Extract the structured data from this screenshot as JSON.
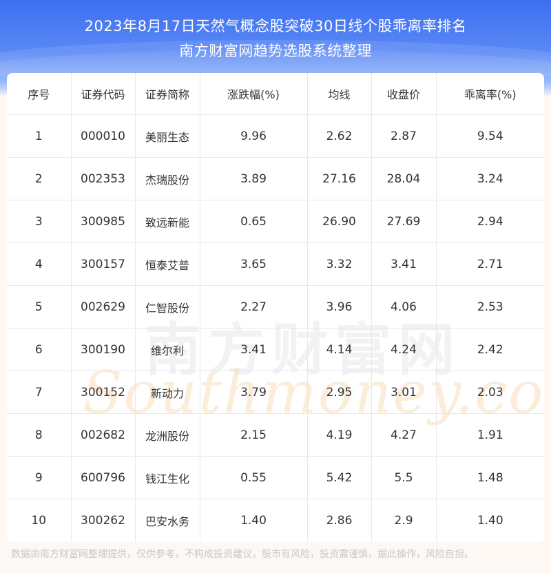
{
  "header": {
    "title_line1": "2023年8月17日天然气概念股突破30日线个股乖离率排名",
    "title_line2": "南方财富网趋势选股系统整理"
  },
  "table": {
    "columns": [
      "序号",
      "证券代码",
      "证券简称",
      "涨跌幅(%)",
      "均线",
      "收盘价",
      "乖离率(%)"
    ],
    "rows": [
      [
        "1",
        "000010",
        "美丽生态",
        "9.96",
        "2.62",
        "2.87",
        "9.54"
      ],
      [
        "2",
        "002353",
        "杰瑞股份",
        "3.89",
        "27.16",
        "28.04",
        "3.24"
      ],
      [
        "3",
        "300985",
        "致远新能",
        "0.65",
        "26.90",
        "27.69",
        "2.94"
      ],
      [
        "4",
        "300157",
        "恒泰艾普",
        "3.65",
        "3.32",
        "3.41",
        "2.71"
      ],
      [
        "5",
        "002629",
        "仁智股份",
        "2.27",
        "3.96",
        "4.06",
        "2.53"
      ],
      [
        "6",
        "300190",
        "维尔利",
        "3.41",
        "4.14",
        "4.24",
        "2.42"
      ],
      [
        "7",
        "300152",
        "新动力",
        "3.79",
        "2.95",
        "3.01",
        "2.03"
      ],
      [
        "8",
        "002682",
        "龙洲股份",
        "2.15",
        "4.19",
        "4.27",
        "1.91"
      ],
      [
        "9",
        "600796",
        "钱江生化",
        "0.55",
        "5.42",
        "5.5",
        "1.48"
      ],
      [
        "10",
        "300262",
        "巴安水务",
        "1.40",
        "2.86",
        "2.9",
        "1.40"
      ]
    ]
  },
  "watermark": {
    "cn": "南方财富网",
    "en": "Southmoney.com"
  },
  "footer": {
    "disclaimer": "数据由南方财富网整理提供，仅供参考，不构成投资建议，股市有风险，投资需谨慎，据此操作，风险自担。"
  },
  "colors": {
    "header_blue": "#3d6ff0",
    "page_background": "#fdf8f3",
    "text": "#333333",
    "grid_line": "#e8e8e8",
    "footer_text": "#c8c8c8"
  }
}
